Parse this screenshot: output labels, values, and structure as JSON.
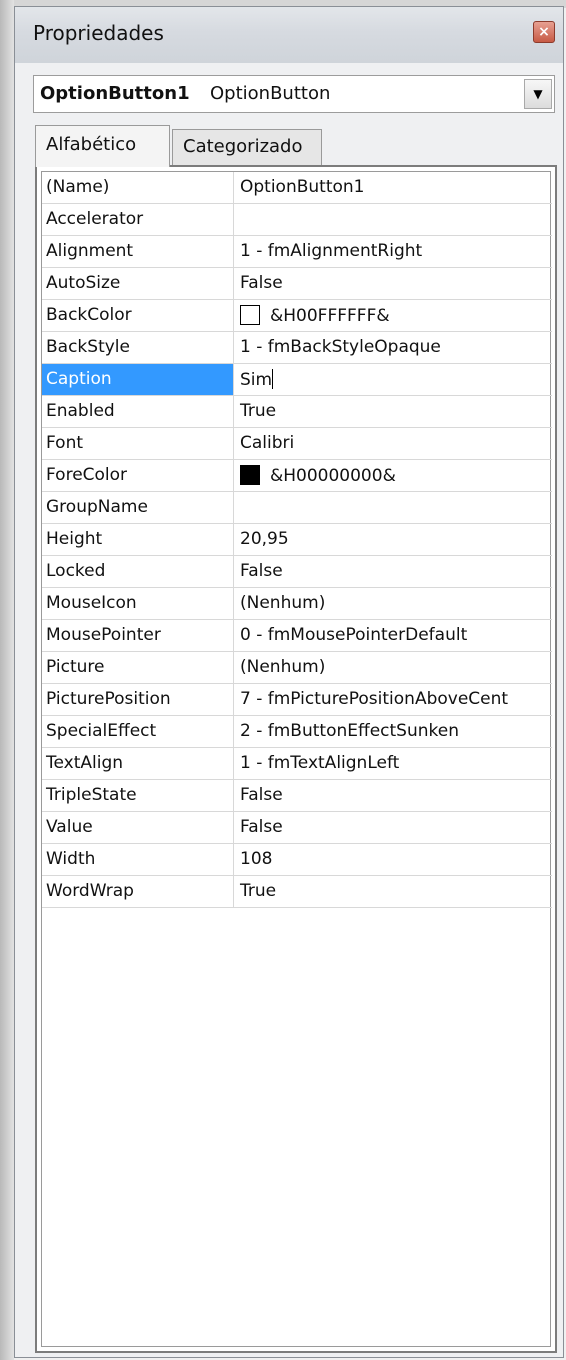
{
  "window": {
    "title": "Propriedades"
  },
  "object_selector": {
    "name": "OptionButton1",
    "type": "OptionButton"
  },
  "tabs": [
    {
      "label": "Alfabético"
    },
    {
      "label": "Categorizado"
    }
  ],
  "properties": [
    {
      "name": "(Name)",
      "value": "OptionButton1"
    },
    {
      "name": "Accelerator",
      "value": ""
    },
    {
      "name": "Alignment",
      "value": "1 - fmAlignmentRight"
    },
    {
      "name": "AutoSize",
      "value": "False"
    },
    {
      "name": "BackColor",
      "value": "&H00FFFFFF&",
      "swatch": "#ffffff"
    },
    {
      "name": "BackStyle",
      "value": "1 - fmBackStyleOpaque"
    },
    {
      "name": "Caption",
      "value": "Sim"
    },
    {
      "name": "Enabled",
      "value": "True"
    },
    {
      "name": "Font",
      "value": "Calibri"
    },
    {
      "name": "ForeColor",
      "value": "&H00000000&",
      "swatch": "#000000"
    },
    {
      "name": "GroupName",
      "value": ""
    },
    {
      "name": "Height",
      "value": "20,95"
    },
    {
      "name": "Locked",
      "value": "False"
    },
    {
      "name": "MouseIcon",
      "value": "(Nenhum)"
    },
    {
      "name": "MousePointer",
      "value": "0 - fmMousePointerDefault"
    },
    {
      "name": "Picture",
      "value": "(Nenhum)"
    },
    {
      "name": "PicturePosition",
      "value": "7 - fmPicturePositionAboveCent"
    },
    {
      "name": "SpecialEffect",
      "value": "2 - fmButtonEffectSunken"
    },
    {
      "name": "TextAlign",
      "value": "1 - fmTextAlignLeft"
    },
    {
      "name": "TripleState",
      "value": "False"
    },
    {
      "name": "Value",
      "value": "False"
    },
    {
      "name": "Width",
      "value": "108"
    },
    {
      "name": "WordWrap",
      "value": "True"
    }
  ],
  "selected_property": "Caption",
  "colors": {
    "selection": "#3399ff",
    "close_button": "#c75a45"
  }
}
